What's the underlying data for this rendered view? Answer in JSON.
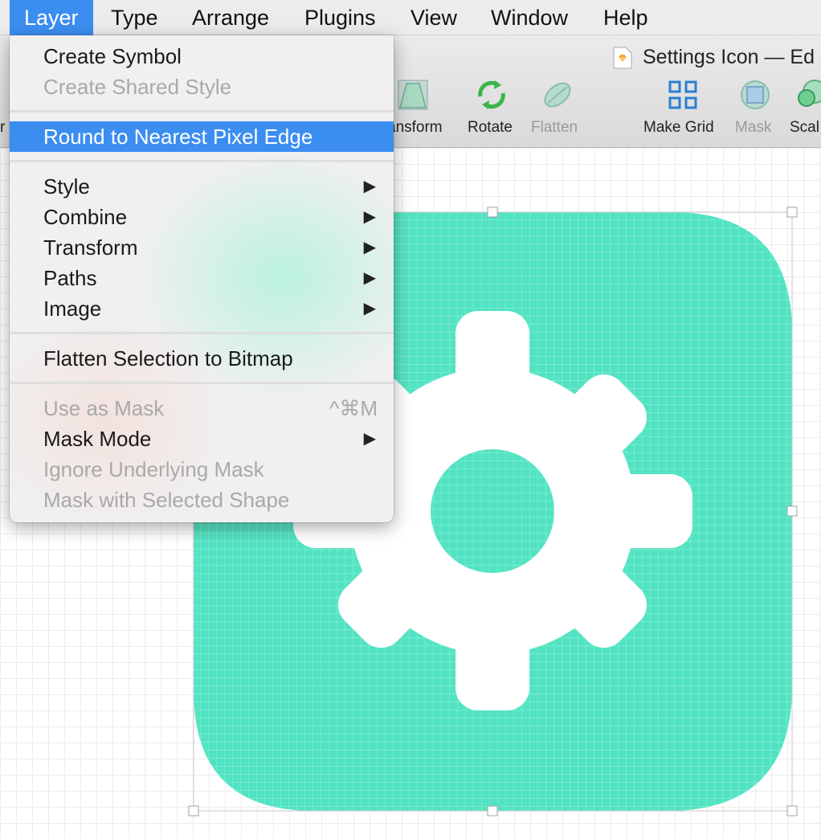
{
  "menubar": {
    "items": [
      "Layer",
      "Type",
      "Arrange",
      "Plugins",
      "View",
      "Window",
      "Help"
    ],
    "active": "Layer"
  },
  "window": {
    "document_title": "Settings Icon — Ed",
    "document_icon": "sketch-document-icon"
  },
  "toolbar": {
    "partial_left": "r",
    "tools": [
      {
        "label": "ansform",
        "icon": "transform-icon",
        "enabled": true
      },
      {
        "label": "Rotate",
        "icon": "rotate-icon",
        "enabled": true
      },
      {
        "label": "Flatten",
        "icon": "flatten-icon",
        "enabled": false
      },
      {
        "label": "Make Grid",
        "icon": "make-grid-icon",
        "enabled": true
      },
      {
        "label": "Mask",
        "icon": "mask-icon",
        "enabled": false
      },
      {
        "label": "Scal",
        "icon": "scale-icon",
        "enabled": true
      }
    ]
  },
  "layer_menu": {
    "group1": {
      "create_symbol": "Create Symbol",
      "create_shared_style": "Create Shared Style"
    },
    "group2": {
      "round_to_pixel": "Round to Nearest Pixel Edge"
    },
    "group3": {
      "style": "Style",
      "combine": "Combine",
      "transform": "Transform",
      "paths": "Paths",
      "image": "Image"
    },
    "group4": {
      "flatten_bitmap": "Flatten Selection to Bitmap"
    },
    "group5": {
      "use_as_mask": "Use as Mask",
      "use_as_mask_shortcut": "^⌘M",
      "mask_mode": "Mask Mode",
      "ignore_underlying_mask": "Ignore Underlying Mask",
      "mask_with_selected_shape": "Mask with Selected Shape"
    },
    "submenu_arrow": "▶",
    "highlighted": "Round to Nearest Pixel Edge"
  },
  "artwork": {
    "shape": "settings-gear-icon",
    "fill_color": "#52e3c2",
    "grid_line_color": "#8af0d8"
  }
}
